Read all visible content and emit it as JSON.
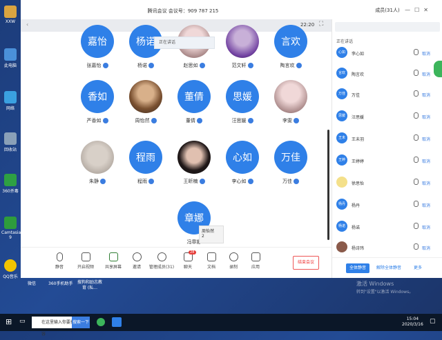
{
  "window": {
    "title": "腾讯会议 会议号：909 787 215",
    "time": "22:20"
  },
  "desktop_icons": [
    {
      "label": "XXW",
      "color": "#d9a441"
    },
    {
      "label": "此电脑",
      "color": "#4a90d9"
    },
    {
      "label": "网络",
      "color": "#3aa0e0"
    },
    {
      "label": "回收站",
      "color": "#8aa0b8"
    },
    {
      "label": "360杀毒",
      "color": "#2ea043"
    },
    {
      "label": "Camtasia 9",
      "color": "#2e9c3c"
    },
    {
      "label": "QQ音乐",
      "color": "#f2c400"
    }
  ],
  "participants": [
    {
      "avatar": "嘉怡",
      "name": "张嘉怡"
    },
    {
      "avatar": "杨诺",
      "name": "杨诺"
    },
    {
      "avatar": "",
      "name": "赵思如"
    },
    {
      "avatar": "",
      "name": "范文轩"
    },
    {
      "avatar": "言欢",
      "name": "陶言欢"
    },
    {
      "avatar": "香如",
      "name": "严香如"
    },
    {
      "avatar": "",
      "name": "周怡然"
    },
    {
      "avatar": "董倩",
      "name": "董倩"
    },
    {
      "avatar": "思媛",
      "name": "汪思媛"
    },
    {
      "avatar": "",
      "name": "李雯"
    },
    {
      "avatar": "",
      "name": "朱静"
    },
    {
      "avatar": "程雨",
      "name": "程雨"
    },
    {
      "avatar": "",
      "name": "王昕楠"
    },
    {
      "avatar": "心如",
      "name": "李心如"
    },
    {
      "avatar": "万佳",
      "name": "万佳"
    },
    {
      "avatar": "章娜",
      "name": "冯章娜"
    }
  ],
  "popup_text": "正在讲话",
  "tooltip": {
    "line1": "周怡然",
    "line2": "2"
  },
  "toolbar": [
    {
      "label": "静音",
      "icon": "microphone-icon"
    },
    {
      "label": "开启视频",
      "icon": "camera-off-icon"
    },
    {
      "label": "共享屏幕",
      "icon": "screen-share-icon"
    },
    {
      "label": "邀请",
      "icon": "invite-icon"
    },
    {
      "label": "管理成员(31)",
      "icon": "members-icon"
    },
    {
      "label": "聊天",
      "icon": "chat-icon",
      "badge": "28"
    },
    {
      "label": "文档",
      "icon": "document-icon"
    },
    {
      "label": "录制",
      "icon": "record-icon"
    },
    {
      "label": "应用",
      "icon": "apps-icon"
    }
  ],
  "end_button": "结束会议",
  "panel": {
    "title": "成员(31人)",
    "search_placeholder": "",
    "section": "正在讲话",
    "members": [
      {
        "avatar": "心如",
        "name": "李心如"
      },
      {
        "avatar": "言欢",
        "name": "陶言欢"
      },
      {
        "avatar": "万佳",
        "name": "万佳"
      },
      {
        "avatar": "思媛",
        "name": "汪思媛"
      },
      {
        "avatar": "王未",
        "name": "王未羽"
      },
      {
        "avatar": "王婷",
        "name": "王婷婷"
      },
      {
        "avatar": "",
        "name": "徐思怡"
      },
      {
        "avatar": "杨丹",
        "name": "杨丹"
      },
      {
        "avatar": "杨诺",
        "name": "杨诺"
      },
      {
        "avatar": "",
        "name": "杨诗玮"
      }
    ],
    "member_action": "取消",
    "mute_all": "全体静音",
    "unmute_all": "解除全体静音",
    "more": "更多"
  },
  "dock": [
    {
      "label": "微信"
    },
    {
      "label": "360手机助手"
    },
    {
      "label": "搜狗和励志教育 (私..."
    }
  ],
  "taskbar": {
    "search_placeholder": "在这里输入你要搜索的内容",
    "search_button": "搜索一下",
    "time": "15:04",
    "date": "2020/3/16"
  },
  "watermark": {
    "line1": "激活 Windows",
    "line2": "转到\"设置\"以激活 Windows。"
  }
}
